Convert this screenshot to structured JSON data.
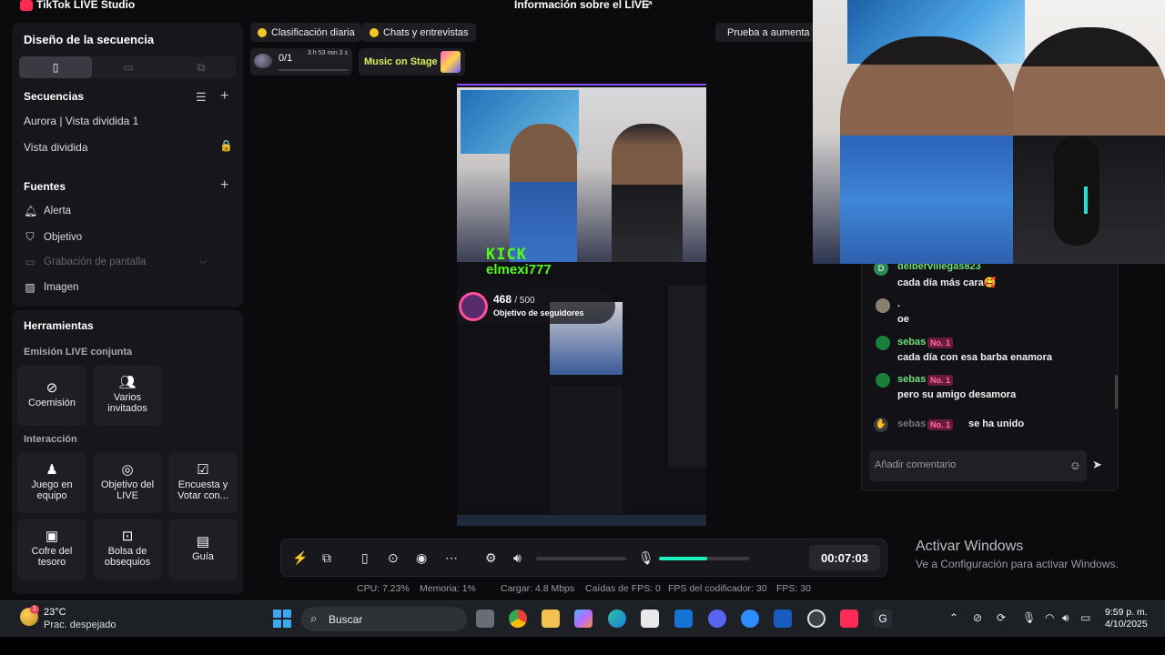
{
  "app": {
    "title": "TikTok LIVE Studio",
    "live_info": "Información sobre el LIVE"
  },
  "sequence_design": {
    "title": "Diseño de la secuencia",
    "sequences_title": "Secuencias",
    "sequence_items": [
      "Aurora | Vista dividida 1",
      "Vista dividida"
    ],
    "sources_title": "Fuentes",
    "sources": [
      {
        "label": "Alerta",
        "icon": "bell-icon"
      },
      {
        "label": "Objetivo",
        "icon": "target-shield-icon"
      },
      {
        "label": "Grabación de pantalla",
        "icon": "monitor-icon"
      },
      {
        "label": "Imagen",
        "icon": "image-icon"
      }
    ]
  },
  "tools": {
    "title": "Herramientas",
    "joint_title": "Emisión LIVE conjunta",
    "joint": [
      "Coemisión",
      "Varios invitados"
    ],
    "interaction_title": "Interacción",
    "interaction": [
      "Juego en equipo",
      "Objetivo del LIVE",
      "Encuesta y Votar con...",
      "Cofre del tesoro",
      "Bolsa de obsequios",
      "Guía"
    ]
  },
  "top_chips": [
    "Clasificación diaria",
    "Chats y entrevistas",
    "Prueba a aumenta"
  ],
  "progress_card": {
    "count": "0/1",
    "time": "3 h 53 min 3 s"
  },
  "music": {
    "label": "Music on Stage"
  },
  "preview": {
    "kick": "KICK",
    "kick_name": "elmexi777",
    "goal_current": "468",
    "goal_total": "/ 500",
    "goal_label": "Objetivo de seguidores"
  },
  "controls": {
    "timer": "00:07:03",
    "mic_level": 0.54
  },
  "stats": [
    {
      "label": "CPU:",
      "value": "7.23%"
    },
    {
      "label": "Memoria:",
      "value": "1%"
    },
    {
      "label": "Cargar:",
      "value": "4.8 Mbps"
    },
    {
      "label": "Caídas de FPS:",
      "value": "0"
    },
    {
      "label": "FPS del codificador:",
      "value": "30"
    },
    {
      "label": "FPS:",
      "value": "30"
    }
  ],
  "chat": {
    "messages": [
      {
        "user": "delbervillegas823",
        "text": "cada día más cara🥰",
        "badge": "",
        "avatar": "D"
      },
      {
        "user": ".",
        "text": "oe",
        "badge": "",
        "avatar": ""
      },
      {
        "user": "sebas",
        "text": "cada día con esa barba enamora",
        "badge": "No. 1",
        "avatar": ""
      },
      {
        "user": "sebas",
        "text": "pero su amigo desamora",
        "badge": "No. 1",
        "avatar": ""
      }
    ],
    "join": {
      "user": "sebas",
      "badge": "No. 1",
      "text": "se ha unido"
    },
    "placeholder": "Añadir comentario"
  },
  "activate_windows": {
    "title": "Activar Windows",
    "subtitle": "Ve a Configuración para activar Windows."
  },
  "taskbar": {
    "temp": "23°C",
    "condition": "Prac. despejado",
    "weather_badge": "1",
    "search": "Buscar",
    "time": "9:59 p. m.",
    "date": "4/10/2025"
  }
}
